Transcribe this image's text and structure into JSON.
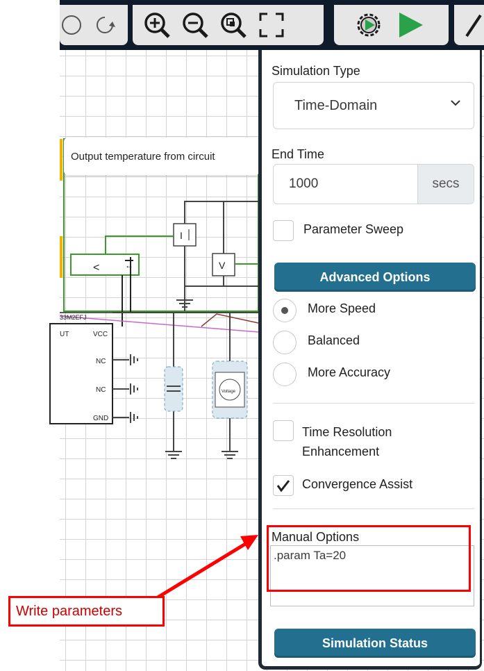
{
  "toolbar": {
    "buttons": [
      "undo-icon",
      "redo-icon",
      "zoom-in-icon",
      "zoom-out-icon",
      "zoom-fit-icon",
      "fullscreen-icon",
      "settings-icon",
      "run-icon",
      "probe-icon"
    ]
  },
  "canvas": {
    "tooltip": "Output temperature from circuit",
    "comparator_label": "<",
    "part_label": "33M2EFJ",
    "pins_left": [
      "UT"
    ],
    "pins_right": [
      "VCC",
      "NC",
      "NC",
      "GND"
    ],
    "voltage_label": "Voltage",
    "meter_i": "I",
    "meter_v": "V"
  },
  "panel": {
    "sim_type_label": "Simulation Type",
    "sim_type_value": "Time-Domain",
    "end_time_label": "End Time",
    "end_time_value": "1000",
    "end_time_unit": "secs",
    "param_sweep_label": "Parameter Sweep",
    "advanced_label": "Advanced Options",
    "modes": [
      {
        "label": "More Speed",
        "selected": true
      },
      {
        "label": "Balanced",
        "selected": false
      },
      {
        "label": "More Accuracy",
        "selected": false
      }
    ],
    "time_res_label": "Time Resolution Enhancement",
    "convergence_label": "Convergence Assist",
    "convergence_checked": true,
    "manual_label": "Manual Options",
    "manual_value": ".param Ta=20",
    "status_label": "Simulation Status"
  },
  "annotation": {
    "text": "Write parameters",
    "color": "#ff0000"
  },
  "colors": {
    "accent": "#236f8f",
    "toolbar": "#0f1b2a",
    "wire_green": "#3a9a2a"
  }
}
